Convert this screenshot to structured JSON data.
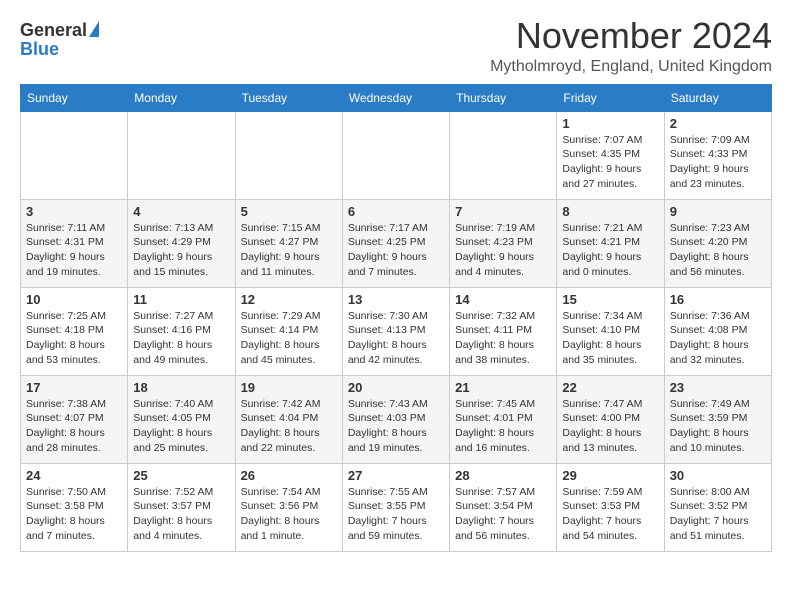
{
  "logo": {
    "general": "General",
    "blue": "Blue"
  },
  "title": "November 2024",
  "location": "Mytholmroyd, England, United Kingdom",
  "days_header": [
    "Sunday",
    "Monday",
    "Tuesday",
    "Wednesday",
    "Thursday",
    "Friday",
    "Saturday"
  ],
  "weeks": [
    [
      {
        "day": "",
        "info": ""
      },
      {
        "day": "",
        "info": ""
      },
      {
        "day": "",
        "info": ""
      },
      {
        "day": "",
        "info": ""
      },
      {
        "day": "",
        "info": ""
      },
      {
        "day": "1",
        "info": "Sunrise: 7:07 AM\nSunset: 4:35 PM\nDaylight: 9 hours and 27 minutes."
      },
      {
        "day": "2",
        "info": "Sunrise: 7:09 AM\nSunset: 4:33 PM\nDaylight: 9 hours and 23 minutes."
      }
    ],
    [
      {
        "day": "3",
        "info": "Sunrise: 7:11 AM\nSunset: 4:31 PM\nDaylight: 9 hours and 19 minutes."
      },
      {
        "day": "4",
        "info": "Sunrise: 7:13 AM\nSunset: 4:29 PM\nDaylight: 9 hours and 15 minutes."
      },
      {
        "day": "5",
        "info": "Sunrise: 7:15 AM\nSunset: 4:27 PM\nDaylight: 9 hours and 11 minutes."
      },
      {
        "day": "6",
        "info": "Sunrise: 7:17 AM\nSunset: 4:25 PM\nDaylight: 9 hours and 7 minutes."
      },
      {
        "day": "7",
        "info": "Sunrise: 7:19 AM\nSunset: 4:23 PM\nDaylight: 9 hours and 4 minutes."
      },
      {
        "day": "8",
        "info": "Sunrise: 7:21 AM\nSunset: 4:21 PM\nDaylight: 9 hours and 0 minutes."
      },
      {
        "day": "9",
        "info": "Sunrise: 7:23 AM\nSunset: 4:20 PM\nDaylight: 8 hours and 56 minutes."
      }
    ],
    [
      {
        "day": "10",
        "info": "Sunrise: 7:25 AM\nSunset: 4:18 PM\nDaylight: 8 hours and 53 minutes."
      },
      {
        "day": "11",
        "info": "Sunrise: 7:27 AM\nSunset: 4:16 PM\nDaylight: 8 hours and 49 minutes."
      },
      {
        "day": "12",
        "info": "Sunrise: 7:29 AM\nSunset: 4:14 PM\nDaylight: 8 hours and 45 minutes."
      },
      {
        "day": "13",
        "info": "Sunrise: 7:30 AM\nSunset: 4:13 PM\nDaylight: 8 hours and 42 minutes."
      },
      {
        "day": "14",
        "info": "Sunrise: 7:32 AM\nSunset: 4:11 PM\nDaylight: 8 hours and 38 minutes."
      },
      {
        "day": "15",
        "info": "Sunrise: 7:34 AM\nSunset: 4:10 PM\nDaylight: 8 hours and 35 minutes."
      },
      {
        "day": "16",
        "info": "Sunrise: 7:36 AM\nSunset: 4:08 PM\nDaylight: 8 hours and 32 minutes."
      }
    ],
    [
      {
        "day": "17",
        "info": "Sunrise: 7:38 AM\nSunset: 4:07 PM\nDaylight: 8 hours and 28 minutes."
      },
      {
        "day": "18",
        "info": "Sunrise: 7:40 AM\nSunset: 4:05 PM\nDaylight: 8 hours and 25 minutes."
      },
      {
        "day": "19",
        "info": "Sunrise: 7:42 AM\nSunset: 4:04 PM\nDaylight: 8 hours and 22 minutes."
      },
      {
        "day": "20",
        "info": "Sunrise: 7:43 AM\nSunset: 4:03 PM\nDaylight: 8 hours and 19 minutes."
      },
      {
        "day": "21",
        "info": "Sunrise: 7:45 AM\nSunset: 4:01 PM\nDaylight: 8 hours and 16 minutes."
      },
      {
        "day": "22",
        "info": "Sunrise: 7:47 AM\nSunset: 4:00 PM\nDaylight: 8 hours and 13 minutes."
      },
      {
        "day": "23",
        "info": "Sunrise: 7:49 AM\nSunset: 3:59 PM\nDaylight: 8 hours and 10 minutes."
      }
    ],
    [
      {
        "day": "24",
        "info": "Sunrise: 7:50 AM\nSunset: 3:58 PM\nDaylight: 8 hours and 7 minutes."
      },
      {
        "day": "25",
        "info": "Sunrise: 7:52 AM\nSunset: 3:57 PM\nDaylight: 8 hours and 4 minutes."
      },
      {
        "day": "26",
        "info": "Sunrise: 7:54 AM\nSunset: 3:56 PM\nDaylight: 8 hours and 1 minute."
      },
      {
        "day": "27",
        "info": "Sunrise: 7:55 AM\nSunset: 3:55 PM\nDaylight: 7 hours and 59 minutes."
      },
      {
        "day": "28",
        "info": "Sunrise: 7:57 AM\nSunset: 3:54 PM\nDaylight: 7 hours and 56 minutes."
      },
      {
        "day": "29",
        "info": "Sunrise: 7:59 AM\nSunset: 3:53 PM\nDaylight: 7 hours and 54 minutes."
      },
      {
        "day": "30",
        "info": "Sunrise: 8:00 AM\nSunset: 3:52 PM\nDaylight: 7 hours and 51 minutes."
      }
    ]
  ]
}
